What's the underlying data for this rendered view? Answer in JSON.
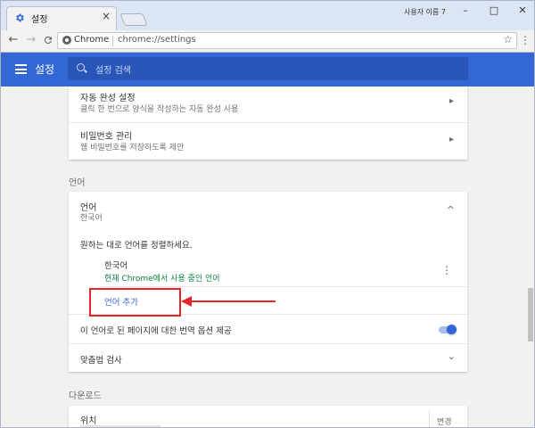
{
  "browser": {
    "tab_title": "설정",
    "tab_close": "×",
    "profile_label": "사용자 이름 7",
    "window_controls": {
      "minimize": "–",
      "maximize": "□",
      "close": "✕"
    },
    "omnibox": {
      "chip": "Chrome",
      "url": "chrome://settings",
      "star": "☆"
    },
    "nav": {
      "back": "←",
      "forward": "→",
      "reload": "C"
    },
    "menu": "⋮"
  },
  "header": {
    "title": "설정",
    "search_placeholder": "설정 검색"
  },
  "autofill_section": {
    "items": [
      {
        "title": "자동 완성 설정",
        "subtitle": "클릭 한 번으로 양식을 작성하는 자동 완성 사용"
      },
      {
        "title": "비밀번호 관리",
        "subtitle": "웹 비밀번호를 저장하도록 제안"
      }
    ]
  },
  "languages_section": {
    "label": "언어",
    "header_title": "언어",
    "header_subtitle": "한국어",
    "collapse_icon": "^",
    "order_hint": "원하는 대로 언어를 정렬하세요.",
    "language": {
      "name": "한국어",
      "status": "현재 Chrome에서 사용 중인 언어"
    },
    "add_language": "언어 추가",
    "translate_offer": "이 언어로 된 페이지에 대한 번역 옵션 제공",
    "translate_enabled": true,
    "spellcheck": "맞춤법 검사"
  },
  "downloads_section": {
    "label": "다운로드",
    "location_title": "위치",
    "change_button": "변경"
  },
  "colors": {
    "accent": "#3367d6",
    "status_green": "#0b8043",
    "annotation_red": "#e8232a"
  }
}
